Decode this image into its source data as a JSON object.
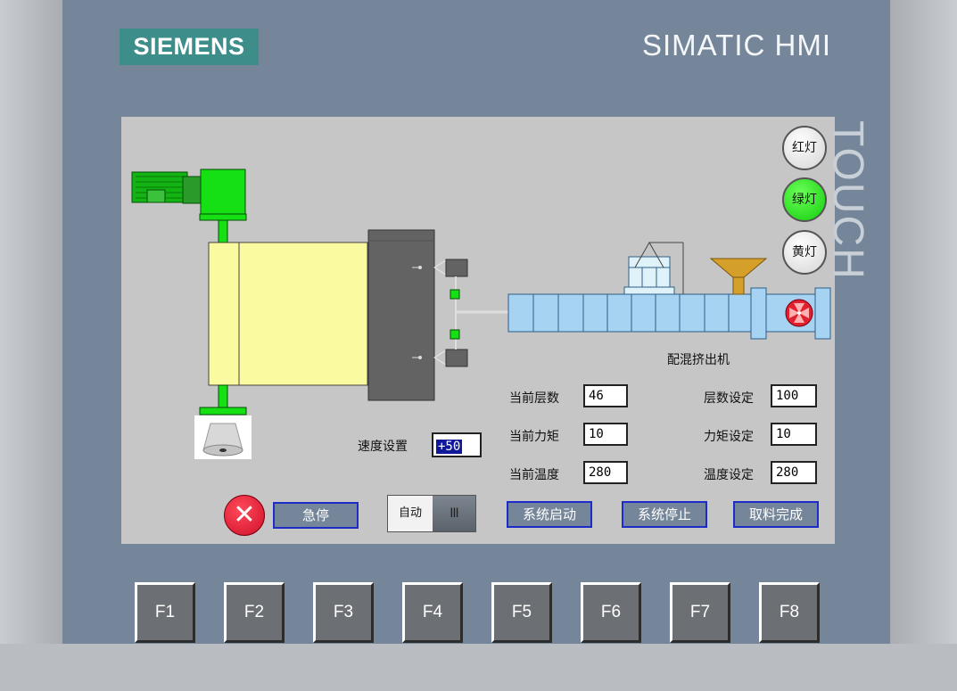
{
  "device": {
    "brand": "SIEMENS",
    "product": "SIMATIC HMI",
    "side_label": "TOUCH"
  },
  "lamps": {
    "red": {
      "label": "红灯",
      "state": "off"
    },
    "green": {
      "label": "绿灯",
      "state": "on"
    },
    "yellow": {
      "label": "黄灯",
      "state": "off"
    }
  },
  "machine": {
    "extruder_caption": "配混挤出机"
  },
  "status": {
    "current_layers": {
      "label": "当前层数",
      "value": "46"
    },
    "current_torque": {
      "label": "当前力矩",
      "value": "10"
    },
    "current_temp": {
      "label": "当前温度",
      "value": "280"
    }
  },
  "setpoints": {
    "layers": {
      "label": "层数设定",
      "value": "100"
    },
    "torque": {
      "label": "力矩设定",
      "value": "10"
    },
    "temp": {
      "label": "温度设定",
      "value": "280"
    }
  },
  "speed": {
    "label": "速度设置",
    "value": "+50"
  },
  "controls": {
    "estop_icon": "✕",
    "estop_label": "急停",
    "mode_label": "自动",
    "mode_knob": "III",
    "start_label": "系统启动",
    "stop_label": "系统停止",
    "take_label": "取料完成"
  },
  "function_keys": [
    "F1",
    "F2",
    "F3",
    "F4",
    "F5",
    "F6",
    "F7",
    "F8"
  ],
  "colors": {
    "bezel": "#75869a",
    "screen_bg": "#c6c6c6",
    "button_border": "#1b2cc7",
    "lamp_on": "#11cc0a",
    "motor_green": "#14e014",
    "drum_yellow": "#fafaa0",
    "barrel_blue": "#a6d3f2",
    "hopper_gold": "#d4a02a"
  }
}
